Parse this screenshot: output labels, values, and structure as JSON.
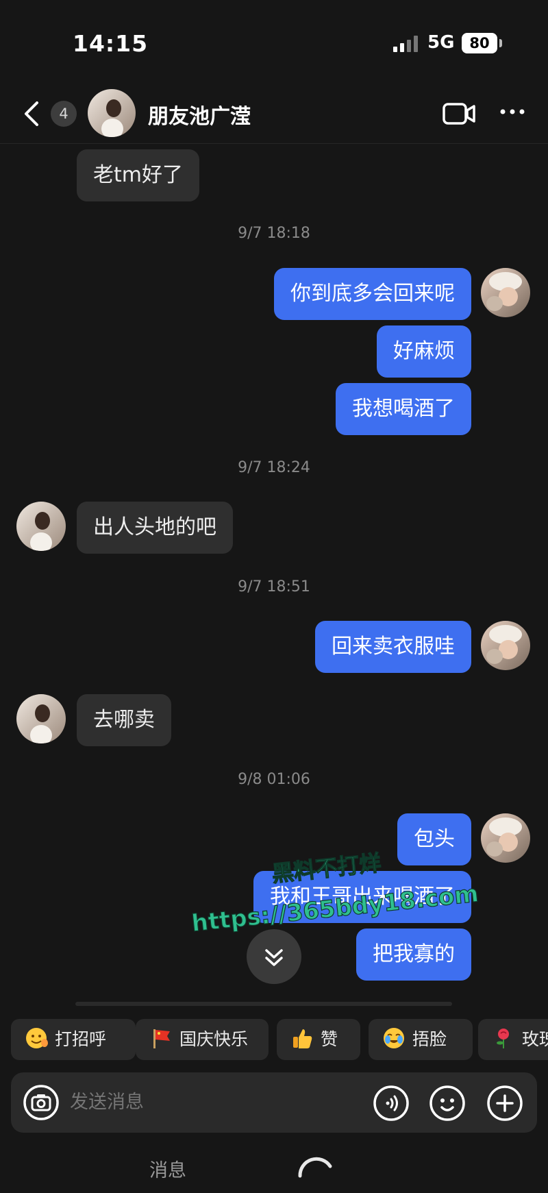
{
  "status_bar": {
    "time": "14:15",
    "network": "5G",
    "battery": "80"
  },
  "header": {
    "unread_count": "4",
    "contact_name": "朋友池广滢"
  },
  "messages": [
    {
      "from": "them",
      "text": "老tm好了"
    },
    {
      "timestamp": "9/7 18:18"
    },
    {
      "from": "me",
      "text": "你到底多会回来呢"
    },
    {
      "from": "me",
      "text": "好麻烦"
    },
    {
      "from": "me",
      "text": "我想喝酒了"
    },
    {
      "timestamp": "9/7 18:24"
    },
    {
      "from": "them",
      "text": "出人头地的吧"
    },
    {
      "timestamp": "9/7 18:51"
    },
    {
      "from": "me",
      "text": "回来卖衣服哇"
    },
    {
      "from": "them",
      "text": "去哪卖"
    },
    {
      "timestamp": "9/8 01:06"
    },
    {
      "from": "me",
      "text": "包头"
    },
    {
      "from": "me",
      "text": "我和王哥出来喝酒了"
    },
    {
      "from": "me",
      "text": "把我寡的"
    }
  ],
  "watermark": {
    "line1": "黑料不打烊",
    "line2": "https://365bdy18.com"
  },
  "quick_replies": [
    {
      "label": "打招呼",
      "icon": "wave-emoji-icon"
    },
    {
      "label": "国庆快乐",
      "icon": "flag-icon"
    },
    {
      "label": "赞",
      "icon": "thumbs-up-icon"
    },
    {
      "label": "捂脸",
      "icon": "facepalm-emoji-icon"
    },
    {
      "label": "玫瑰",
      "icon": "rose-icon"
    }
  ],
  "input": {
    "placeholder": "发送消息"
  },
  "bottom_nav": {
    "label": "消息"
  },
  "colors": {
    "background": "#161616",
    "sent_bubble": "#3e6ff0",
    "received_bubble": "#2f2f2f",
    "watermark": "#2fbf8f"
  }
}
